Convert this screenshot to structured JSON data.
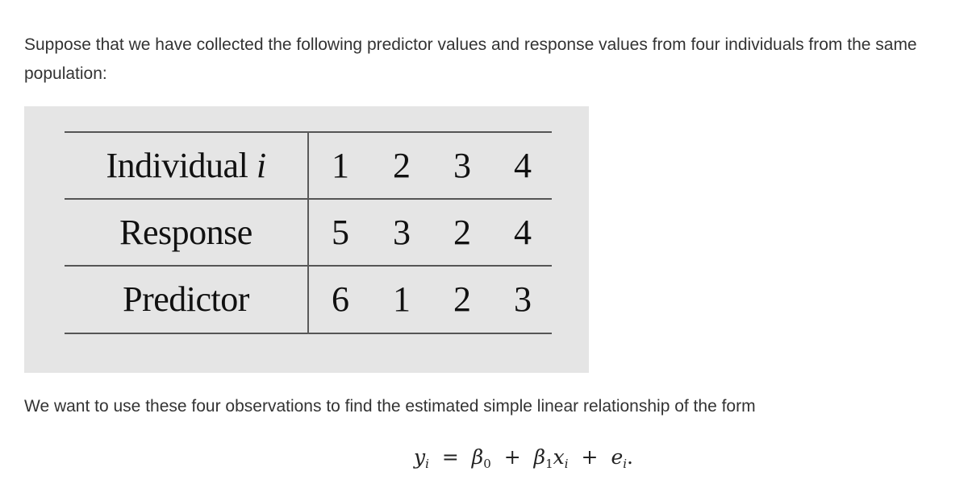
{
  "intro_text": "Suppose that we have collected the following predictor values and response values from four individuals from the same population:",
  "table": {
    "header": {
      "label": "Individual",
      "label_var": "i",
      "values": [
        "1",
        "2",
        "3",
        "4"
      ]
    },
    "rows": [
      {
        "label": "Response",
        "values": [
          "5",
          "3",
          "2",
          "4"
        ]
      },
      {
        "label": "Predictor",
        "values": [
          "6",
          "1",
          "2",
          "3"
        ]
      }
    ],
    "background_color": "#e5e5e5"
  },
  "question_text": "We want to use these four observations to find the estimated simple linear relationship of the form",
  "equation": {
    "lhs": "y",
    "lhs_sub": "i",
    "equals": "=",
    "beta0": "β",
    "beta0_sub": "0",
    "plus1": "+",
    "beta1": "β",
    "beta1_sub": "1",
    "x": "x",
    "x_sub": "i",
    "plus2": "+",
    "e": "e",
    "e_sub": "i",
    "end": "."
  }
}
